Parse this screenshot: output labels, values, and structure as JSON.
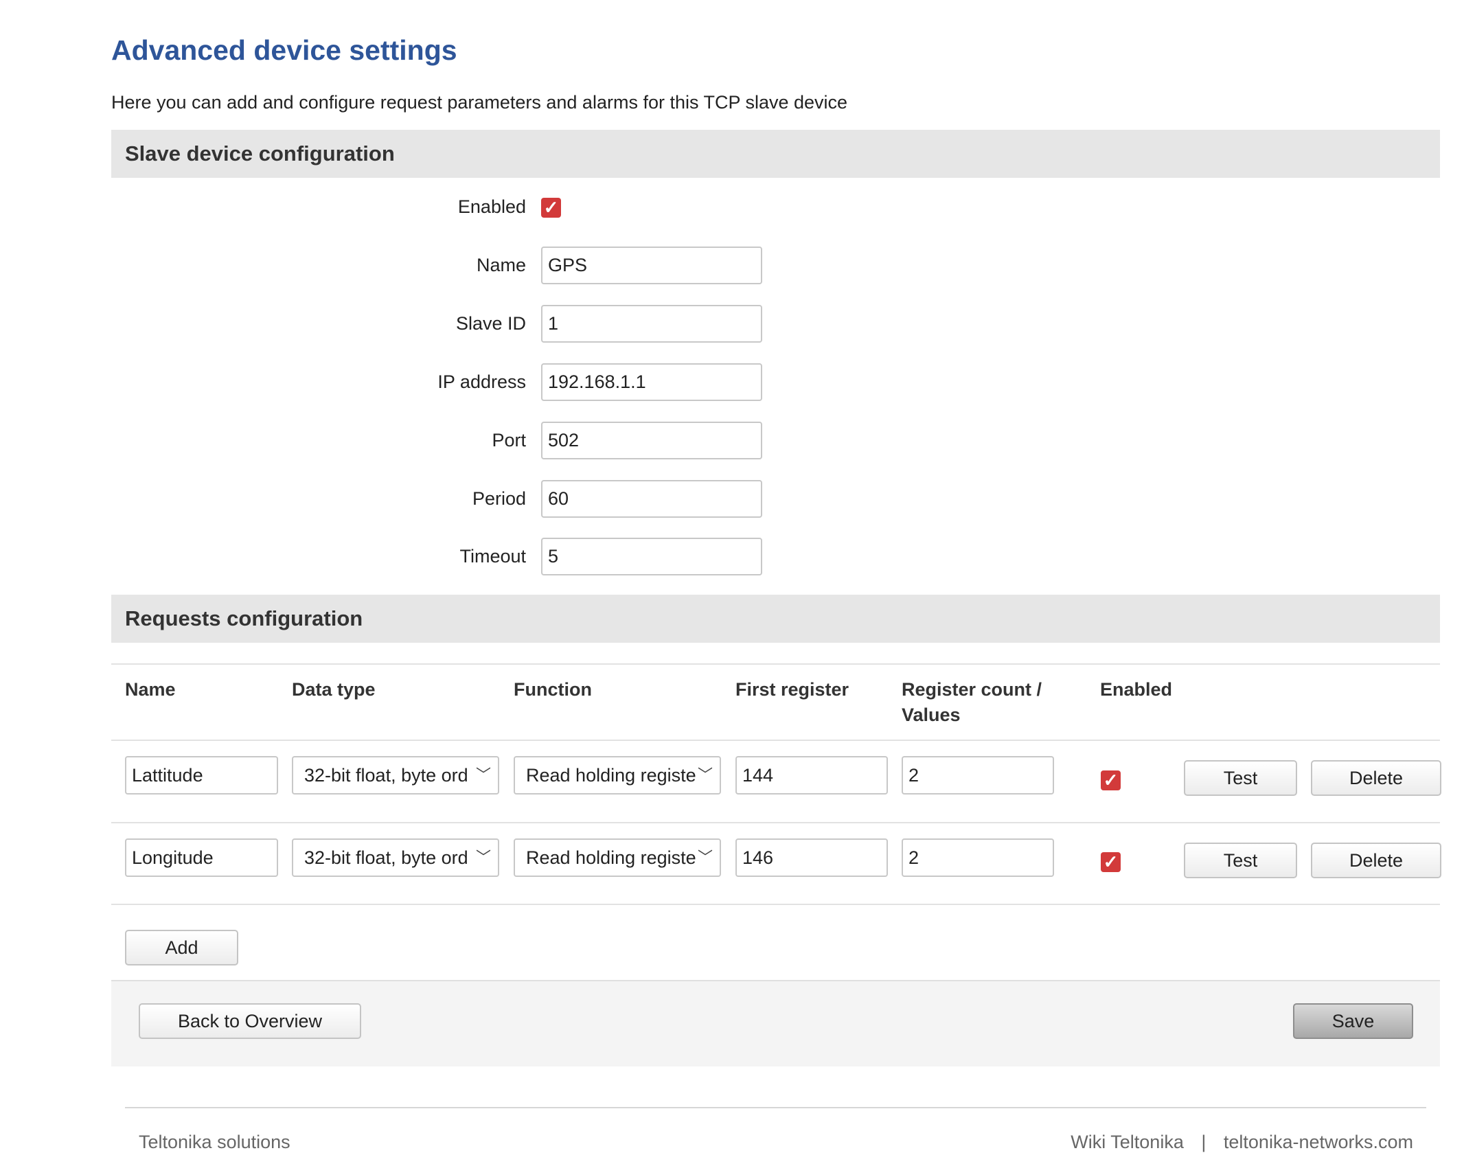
{
  "page": {
    "title": "Advanced device settings",
    "description": "Here you can add and configure request parameters and alarms for this TCP slave device"
  },
  "slave_config": {
    "header": "Slave device configuration",
    "enabled_label": "Enabled",
    "enabled": true,
    "fields": [
      {
        "label": "Name",
        "value": "GPS"
      },
      {
        "label": "Slave ID",
        "value": "1"
      },
      {
        "label": "IP address",
        "value": "192.168.1.1"
      },
      {
        "label": "Port",
        "value": "502"
      },
      {
        "label": "Period",
        "value": "60"
      },
      {
        "label": "Timeout",
        "value": "5"
      }
    ]
  },
  "requests": {
    "header": "Requests configuration",
    "columns": [
      "Name",
      "Data type",
      "Function",
      "First register",
      "Register count /",
      "Values",
      "Enabled"
    ],
    "rows": [
      {
        "name": "Lattitude",
        "data_type": "32-bit float, byte ord",
        "function": "Read holding registe",
        "first_register": "144",
        "count": "2",
        "enabled": true,
        "test_label": "Test",
        "delete_label": "Delete"
      },
      {
        "name": "Longitude",
        "data_type": "32-bit float, byte ord",
        "function": "Read holding registe",
        "first_register": "146",
        "count": "2",
        "enabled": true,
        "test_label": "Test",
        "delete_label": "Delete"
      }
    ],
    "add_label": "Add"
  },
  "actions": {
    "back_label": "Back to Overview",
    "save_label": "Save"
  },
  "footer": {
    "left": "Teltonika solutions",
    "wiki": "Wiki Teltonika",
    "separator": "|",
    "site": "teltonika-networks.com"
  },
  "colors": {
    "title": "#2e5599",
    "checkbox": "#d23a3a",
    "section_bg": "#e6e6e6"
  },
  "icons": {
    "checkbox": "checkmark-icon",
    "select": "chevron-down-icon"
  }
}
